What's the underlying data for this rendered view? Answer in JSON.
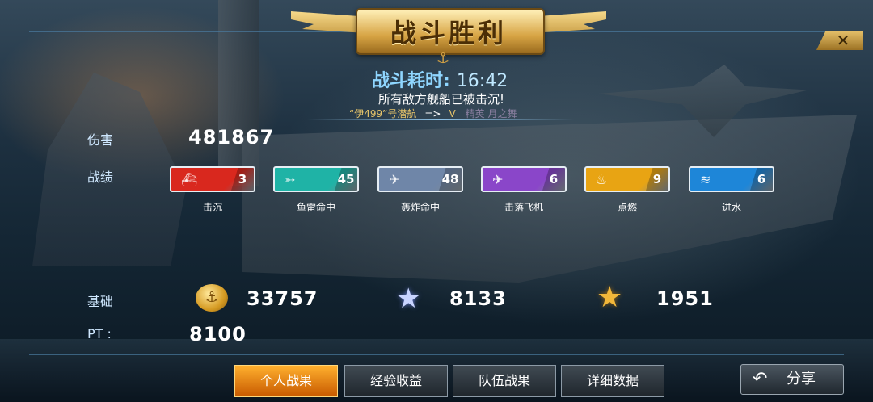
{
  "header": {
    "title": "战斗胜利",
    "close_icon": "close-icon"
  },
  "battle": {
    "duration_label": "战斗耗时:",
    "duration_value": "16:42",
    "result_text": "所有敌方舰船已被击沉!",
    "submarine": "“伊499”号潜航",
    "arrow": "=>",
    "grade": "V",
    "next_text": "精英 月之舞"
  },
  "damage": {
    "label": "伤害",
    "value": "481867"
  },
  "record": {
    "label": "战绩",
    "items": [
      {
        "label": "击沉",
        "count": "3",
        "icon": "sunk-ship-icon",
        "color": "#d9281e"
      },
      {
        "label": "鱼雷命中",
        "count": "45",
        "icon": "torpedo-icon",
        "color": "#1fb3a6"
      },
      {
        "label": "轰炸命中",
        "count": "48",
        "icon": "bomb-icon",
        "color": "#6f86a8"
      },
      {
        "label": "击落飞机",
        "count": "6",
        "icon": "plane-down-icon",
        "color": "#8a46c9"
      },
      {
        "label": "点燃",
        "count": "9",
        "icon": "fire-icon",
        "color": "#e8a413"
      },
      {
        "label": "进水",
        "count": "6",
        "icon": "flood-icon",
        "color": "#1e86d8"
      }
    ]
  },
  "base": {
    "label": "基础",
    "coins": "33757",
    "silver_star": "8133",
    "gold_star": "1951"
  },
  "pt": {
    "label": "PT :",
    "value": "8100"
  },
  "tabs": [
    {
      "label": "个人战果",
      "active": true
    },
    {
      "label": "经验收益",
      "active": false
    },
    {
      "label": "队伍战果",
      "active": false
    },
    {
      "label": "详细数据",
      "active": false
    }
  ],
  "share": {
    "label": "分享",
    "icon": "back-arrow-icon"
  }
}
